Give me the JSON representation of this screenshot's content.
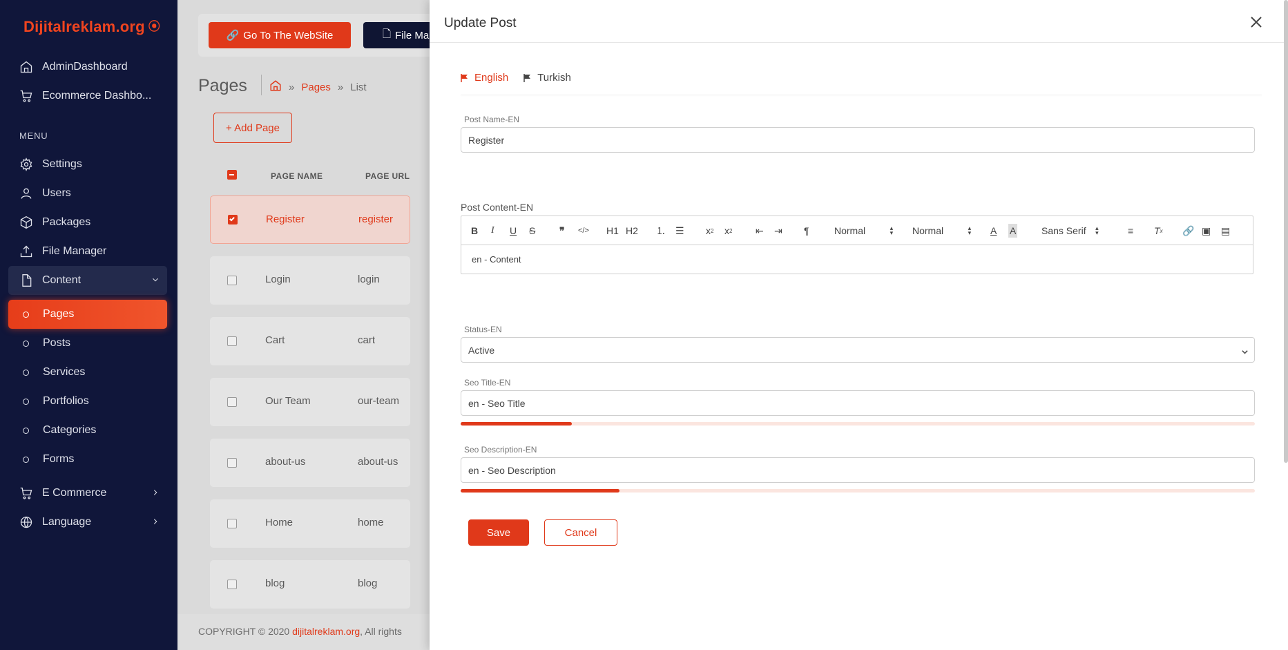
{
  "brand": "Dijitalreklam.org",
  "sidebar": {
    "top_items": [
      {
        "label": "AdminDashboard",
        "icon": "home-icon"
      },
      {
        "label": "Ecommerce Dashbo...",
        "icon": "cart-icon"
      }
    ],
    "menu_heading": "MENU",
    "items": [
      {
        "label": "Settings",
        "icon": "gear-icon"
      },
      {
        "label": "Users",
        "icon": "user-icon"
      },
      {
        "label": "Packages",
        "icon": "package-icon"
      },
      {
        "label": "File Manager",
        "icon": "upload-icon"
      },
      {
        "label": "Content",
        "icon": "file-icon"
      }
    ],
    "content_sub": [
      "Pages",
      "Posts",
      "Services",
      "Portfolios",
      "Categories",
      "Forms"
    ],
    "bottom_items": [
      {
        "label": "E Commerce",
        "icon": "cart-icon"
      },
      {
        "label": "Language",
        "icon": "globe-icon"
      }
    ]
  },
  "main": {
    "go_website": "Go To The WebSite",
    "file_manager": "File Ma",
    "page_title": "Pages",
    "breadcrumb": {
      "pages": "Pages",
      "list": "List",
      "sep": "»"
    },
    "add_page": "+ Add Page",
    "columns": [
      "PAGE NAME",
      "PAGE URL"
    ],
    "rows": [
      {
        "name": "Register",
        "url": "register",
        "checked": true
      },
      {
        "name": "Login",
        "url": "login",
        "checked": false
      },
      {
        "name": "Cart",
        "url": "cart",
        "checked": false
      },
      {
        "name": "Our Team",
        "url": "our-team",
        "checked": false
      },
      {
        "name": "about-us",
        "url": "about-us",
        "checked": false
      },
      {
        "name": "Home",
        "url": "home",
        "checked": false
      },
      {
        "name": "blog",
        "url": "blog",
        "checked": false
      }
    ],
    "footer_prefix": "COPYRIGHT © 2020 ",
    "footer_link": "dijitalreklam.org",
    "footer_suffix": ", All rights"
  },
  "panel": {
    "title": "Update Post",
    "tabs": [
      "English",
      "Turkish"
    ],
    "post_name_label": "Post Name-EN",
    "post_name_value": "Register",
    "post_content_label": "Post Content-EN",
    "toolbar": {
      "header1": "H1",
      "header2": "H2",
      "size": "Normal",
      "header": "Normal",
      "font": "Sans Serif"
    },
    "content_value": "en - Content",
    "status_label": "Status-EN",
    "status_value": "Active",
    "seo_title_label": "Seo Title-EN",
    "seo_title_value": "en - Seo Title",
    "seo_title_progress": 0.14,
    "seo_desc_label": "Seo Description-EN",
    "seo_desc_value": "en - Seo Description",
    "seo_desc_progress": 0.2,
    "save": "Save",
    "cancel": "Cancel"
  },
  "colors": {
    "accent": "#e0391a",
    "sidebar": "#10163a"
  }
}
